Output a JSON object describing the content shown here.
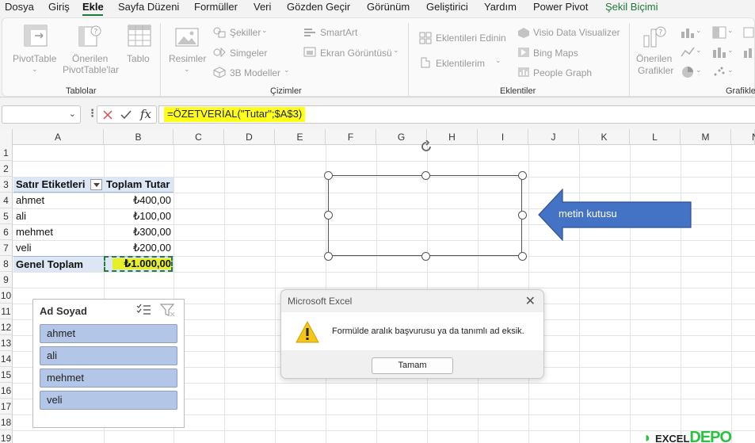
{
  "menu": {
    "tabs": [
      "Dosya",
      "Giriş",
      "Ekle",
      "Sayfa Düzeni",
      "Formüller",
      "Veri",
      "Gözden Geçir",
      "Görünüm",
      "Geliştirici",
      "Yardım",
      "Power Pivot",
      "Şekil Biçimi"
    ],
    "active": "Ekle"
  },
  "ribbon": {
    "pivottable": "PivotTable",
    "recommended_pivot_1": "Önerilen",
    "recommended_pivot_2": "PivotTable'lar",
    "table": "Tablo",
    "group_tables": "Tablolar",
    "pictures": "Resimler",
    "shapes": "Şekiller",
    "icons": "Simgeler",
    "models_3d": "3B Modeller",
    "smartart": "SmartArt",
    "screenshot": "Ekran Görüntüsü",
    "group_illustrations": "Çizimler",
    "get_addins": "Eklentileri Edinin",
    "my_addins": "Eklentilerim",
    "group_addins": "Eklentiler",
    "visio": "Visio Data Visualizer",
    "bing_maps": "Bing Maps",
    "people_graph": "People Graph",
    "recommended_charts_1": "Önerilen",
    "recommended_charts_2": "Grafikler",
    "group_charts": "Grafikle"
  },
  "formula_bar": {
    "name_box": "",
    "formula": "=ÖZETVERİAL(\"Tutar\";$A$3)"
  },
  "columns": [
    "A",
    "B",
    "C",
    "D",
    "E",
    "F",
    "G",
    "H",
    "I",
    "J",
    "K",
    "L",
    "M",
    "N"
  ],
  "rows": [
    "1",
    "2",
    "3",
    "4",
    "5",
    "6",
    "7",
    "8",
    "9",
    "10",
    "11",
    "12",
    "13",
    "14",
    "15",
    "16",
    "17",
    "18",
    "19"
  ],
  "pivot": {
    "header_label": "Satır Etiketleri",
    "header_value": "Toplam Tutar",
    "rows": [
      {
        "label": "ahmet",
        "value": "₺400,00"
      },
      {
        "label": "ali",
        "value": "₺100,00"
      },
      {
        "label": "mehmet",
        "value": "₺300,00"
      },
      {
        "label": "veli",
        "value": "₺200,00"
      }
    ],
    "total_label": "Genel Toplam",
    "total_value": "₺1.000,00"
  },
  "callout": {
    "label": "metin kutusu",
    "color": "#4472c4"
  },
  "slicer": {
    "title": "Ad Soyad",
    "items": [
      "ahmet",
      "ali",
      "mehmet",
      "veli"
    ],
    "item_color": "#b4c6e7"
  },
  "dialog": {
    "title": "Microsoft Excel",
    "message": "Formülde aralık başvurusu ya da tanımlı ad eksik.",
    "ok": "Tamam"
  },
  "watermark": {
    "prefix": "EXCEL",
    "brand": "DEPO"
  },
  "colors": {
    "accent_green": "#1f7a3a",
    "formula_highlight": "#ffff1a",
    "pivot_header": "#dce6f5"
  }
}
